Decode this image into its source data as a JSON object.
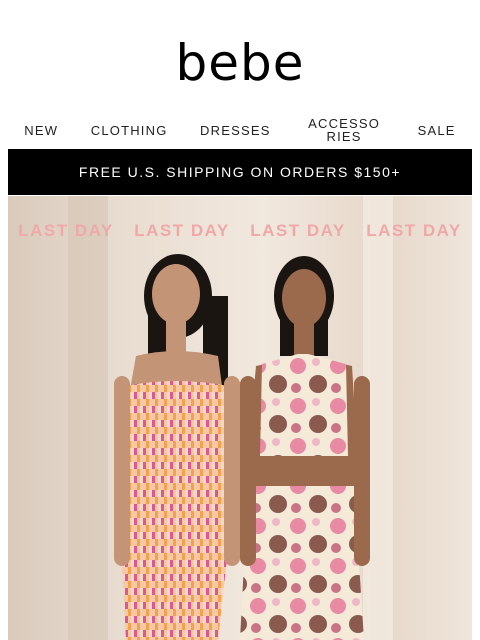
{
  "brand": {
    "logo_text": "bebe"
  },
  "nav": {
    "items": [
      {
        "label": "NEW"
      },
      {
        "label": "CLOTHING"
      },
      {
        "label": "DRESSES"
      },
      {
        "label": "ACCESSORIES"
      },
      {
        "label": "SALE"
      }
    ]
  },
  "banner": {
    "text": "FREE U.S. SHIPPING ON ORDERS $150+"
  },
  "hero": {
    "headline_repeats": [
      "LAST DAY",
      "LAST DAY",
      "LAST DAY",
      "LAST DAY"
    ],
    "accent_color": "#f0a8a8"
  }
}
